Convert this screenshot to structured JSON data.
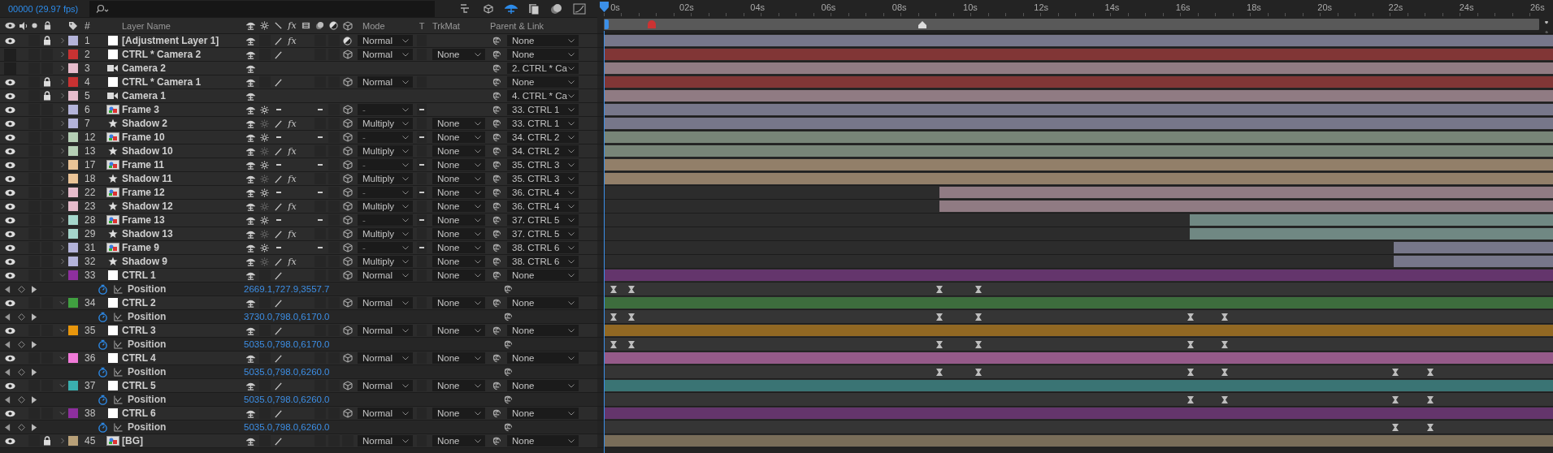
{
  "top_bar": {
    "frame_info": "00000 (29.97 fps)"
  },
  "columns": {
    "number": "#",
    "layer_name": "Layer Name",
    "fx": "fx",
    "mode": "Mode",
    "t": "T",
    "trkmat": "TrkMat",
    "parent": "Parent & Link"
  },
  "ruler": {
    "labels": [
      "0s",
      "02s",
      "04s",
      "06s",
      "08s",
      "10s",
      "12s",
      "14s",
      "16s",
      "18s",
      "20s",
      "22s",
      "24s",
      "26s"
    ]
  },
  "layers": [
    {
      "number": "1",
      "name": "[Adjustment Layer 1]",
      "color": "#b3b3d9",
      "visible": true,
      "locked": true,
      "expanded": false,
      "source": {
        "kind": "solid"
      },
      "switches": {
        "kind": "adjustment"
      },
      "fx_label": "fx",
      "effects_on": true,
      "mode": "Normal",
      "t_switch": {
        "kind": "box"
      },
      "parent": "None",
      "bar": {
        "level": 1
      }
    },
    {
      "number": "2",
      "name": "CTRL * Camera 2",
      "color": "#c83232",
      "visible": false,
      "locked": false,
      "expanded": false,
      "source": {
        "kind": "solid"
      },
      "switches": {
        "kind": "solid"
      },
      "three_d": true,
      "mode": "Normal",
      "t_switch": {
        "kind": "box"
      },
      "trkmat": "None",
      "parent": "None",
      "bar": {
        "level": 1
      }
    },
    {
      "number": "3",
      "name": "Camera 2",
      "color": "#e6bccc",
      "visible": false,
      "locked": false,
      "expanded": false,
      "source": {
        "kind": "camera"
      },
      "switches": {
        "kind": "camera"
      },
      "parent": "2. CTRL * Ca",
      "bar": {
        "level": 1
      }
    },
    {
      "number": "4",
      "name": "CTRL * Camera 1",
      "color": "#c83232",
      "visible": true,
      "locked": true,
      "expanded": false,
      "source": {
        "kind": "solid"
      },
      "switches": {
        "kind": "solid"
      },
      "three_d": true,
      "mode": "Normal",
      "t_switch": {
        "kind": "box"
      },
      "parent": "None",
      "bar": {
        "level": 1
      }
    },
    {
      "number": "5",
      "name": "Camera 1",
      "color": "#e6bccc",
      "visible": true,
      "locked": true,
      "expanded": false,
      "source": {
        "kind": "camera"
      },
      "switches": {
        "kind": "camera"
      },
      "parent": "4. CTRL * Ca",
      "bar": {
        "level": 1
      }
    },
    {
      "number": "6",
      "name": "Frame 3",
      "color": "#b3b3d9",
      "visible": true,
      "locked": false,
      "expanded": false,
      "source": {
        "kind": "footage"
      },
      "switches": {
        "kind": "footage"
      },
      "three_d": true,
      "mode": "-",
      "t_switch": {
        "kind": "dash"
      },
      "parent": "33. CTRL 1",
      "bar": {
        "level": 1
      }
    },
    {
      "number": "7",
      "name": "Shadow 2",
      "color": "#b3b3d9",
      "visible": true,
      "locked": false,
      "expanded": false,
      "source": {
        "kind": "shape"
      },
      "switches": {
        "kind": "shape"
      },
      "fx_label": "fx",
      "effects_on": true,
      "three_d": true,
      "mode": "Multiply",
      "t_switch": {
        "kind": "box"
      },
      "trkmat": "None",
      "parent": "33. CTRL 1",
      "bar": {
        "level": 1
      }
    },
    {
      "number": "12",
      "name": "Frame 10",
      "color": "#b5cfb5",
      "visible": true,
      "locked": false,
      "expanded": false,
      "source": {
        "kind": "footage"
      },
      "switches": {
        "kind": "footage"
      },
      "three_d": true,
      "mode": "-",
      "t_switch": {
        "kind": "dash"
      },
      "trkmat": "None",
      "parent": "34. CTRL 2",
      "bar": {
        "level": 1
      }
    },
    {
      "number": "13",
      "name": "Shadow 10",
      "color": "#b5cfb5",
      "visible": true,
      "locked": false,
      "expanded": false,
      "source": {
        "kind": "shape"
      },
      "switches": {
        "kind": "shape"
      },
      "fx_label": "fx",
      "effects_on": true,
      "three_d": true,
      "mode": "Multiply",
      "t_switch": {
        "kind": "box"
      },
      "trkmat": "None",
      "parent": "34. CTRL 2",
      "bar": {
        "level": 1
      }
    },
    {
      "number": "17",
      "name": "Frame 11",
      "color": "#eac497",
      "visible": true,
      "locked": false,
      "expanded": false,
      "source": {
        "kind": "footage"
      },
      "switches": {
        "kind": "footage"
      },
      "three_d": true,
      "mode": "-",
      "t_switch": {
        "kind": "dash"
      },
      "trkmat": "None",
      "parent": "35. CTRL 3",
      "bar": {
        "level": 1
      }
    },
    {
      "number": "18",
      "name": "Shadow 11",
      "color": "#eac497",
      "visible": true,
      "locked": false,
      "expanded": false,
      "source": {
        "kind": "shape"
      },
      "switches": {
        "kind": "shape"
      },
      "fx_label": "fx",
      "effects_on": true,
      "three_d": true,
      "mode": "Multiply",
      "t_switch": {
        "kind": "box"
      },
      "trkmat": "None",
      "parent": "35. CTRL 3",
      "bar": {
        "level": 1
      }
    },
    {
      "number": "22",
      "name": "Frame 12",
      "color": "#e6bccc",
      "visible": true,
      "locked": false,
      "expanded": false,
      "source": {
        "kind": "footage"
      },
      "switches": {
        "kind": "footage"
      },
      "three_d": true,
      "mode": "-",
      "t_switch": {
        "kind": "dash"
      },
      "trkmat": "None",
      "parent": "36. CTRL 4",
      "bar": {
        "level": 0.646
      }
    },
    {
      "number": "23",
      "name": "Shadow 12",
      "color": "#e6bccc",
      "visible": true,
      "locked": false,
      "expanded": false,
      "source": {
        "kind": "shape"
      },
      "switches": {
        "kind": "shape"
      },
      "fx_label": "fx",
      "effects_on": true,
      "three_d": true,
      "mode": "Multiply",
      "t_switch": {
        "kind": "box"
      },
      "trkmat": "None",
      "parent": "36. CTRL 4",
      "bar": {
        "level": 0.646
      }
    },
    {
      "number": "28",
      "name": "Frame 13",
      "color": "#a5d6cc",
      "visible": true,
      "locked": false,
      "expanded": false,
      "source": {
        "kind": "footage"
      },
      "switches": {
        "kind": "footage"
      },
      "three_d": true,
      "mode": "-",
      "t_switch": {
        "kind": "dash"
      },
      "trkmat": "None",
      "parent": "37. CTRL 5",
      "bar": {
        "level": 0.383
      }
    },
    {
      "number": "29",
      "name": "Shadow 13",
      "color": "#a5d6cc",
      "visible": true,
      "locked": false,
      "expanded": false,
      "source": {
        "kind": "shape"
      },
      "switches": {
        "kind": "shape"
      },
      "fx_label": "fx",
      "effects_on": true,
      "three_d": true,
      "mode": "Multiply",
      "t_switch": {
        "kind": "box"
      },
      "trkmat": "None",
      "parent": "37. CTRL 5",
      "bar": {
        "level": 0.383
      }
    },
    {
      "number": "31",
      "name": "Frame 9",
      "color": "#b3b3d9",
      "visible": true,
      "locked": false,
      "expanded": false,
      "source": {
        "kind": "footage"
      },
      "switches": {
        "kind": "footage"
      },
      "three_d": true,
      "mode": "-",
      "t_switch": {
        "kind": "dash"
      },
      "trkmat": "None",
      "parent": "38. CTRL 6",
      "bar": {
        "level": 0.168
      }
    },
    {
      "number": "32",
      "name": "Shadow 9",
      "color": "#b3b3d9",
      "visible": true,
      "locked": false,
      "expanded": false,
      "source": {
        "kind": "shape"
      },
      "switches": {
        "kind": "shape"
      },
      "fx_label": "fx",
      "effects_on": true,
      "three_d": true,
      "mode": "Multiply",
      "t_switch": {
        "kind": "box"
      },
      "trkmat": "None",
      "parent": "38. CTRL 6",
      "bar": {
        "level": 0.168
      }
    },
    {
      "number": "33",
      "name": "CTRL 1",
      "color": "#8e2f9e",
      "visible": true,
      "locked": false,
      "expanded": true,
      "source": {
        "kind": "solid"
      },
      "switches": {
        "kind": "solid"
      },
      "three_d": true,
      "mode": "Normal",
      "t_switch": {
        "kind": "box"
      },
      "trkmat": "None",
      "parent": "None",
      "bar": {
        "level": 1
      },
      "position": {
        "label": "Position",
        "value": "2669.1,727.9,3557.7",
        "keyframes": [
          {
            "level": 0.01
          },
          {
            "level": 0.029
          },
          {
            "level": 0.354
          },
          {
            "level": 0.395
          }
        ]
      }
    },
    {
      "number": "34",
      "name": "CTRL 2",
      "color": "#40a040",
      "visible": true,
      "locked": false,
      "expanded": true,
      "source": {
        "kind": "solid"
      },
      "switches": {
        "kind": "solid"
      },
      "three_d": true,
      "mode": "Normal",
      "t_switch": {
        "kind": "box"
      },
      "trkmat": "None",
      "parent": "None",
      "bar": {
        "level": 1
      },
      "position": {
        "label": "Position",
        "value": "3730.0,798.0,6170.0",
        "keyframes": [
          {
            "level": 0.01
          },
          {
            "level": 0.029
          },
          {
            "level": 0.354
          },
          {
            "level": 0.395
          },
          {
            "level": 0.618
          },
          {
            "level": 0.654
          }
        ]
      }
    },
    {
      "number": "35",
      "name": "CTRL 3",
      "color": "#e8960c",
      "visible": true,
      "locked": false,
      "expanded": true,
      "source": {
        "kind": "solid"
      },
      "switches": {
        "kind": "solid"
      },
      "three_d": true,
      "mode": "Normal",
      "t_switch": {
        "kind": "box"
      },
      "trkmat": "None",
      "parent": "None",
      "bar": {
        "level": 1
      },
      "position": {
        "label": "Position",
        "value": "5035.0,798.0,6170.0",
        "keyframes": [
          {
            "level": 0.01
          },
          {
            "level": 0.029
          },
          {
            "level": 0.354
          },
          {
            "level": 0.395
          },
          {
            "level": 0.618
          },
          {
            "level": 0.654
          }
        ]
      }
    },
    {
      "number": "36",
      "name": "CTRL 4",
      "color": "#f07ad8",
      "visible": true,
      "locked": false,
      "expanded": true,
      "source": {
        "kind": "solid"
      },
      "switches": {
        "kind": "solid"
      },
      "three_d": true,
      "mode": "Normal",
      "t_switch": {
        "kind": "box"
      },
      "trkmat": "None",
      "parent": "None",
      "bar": {
        "level": 1
      },
      "position": {
        "label": "Position",
        "value": "5035.0,798.0,6260.0",
        "keyframes": [
          {
            "level": 0.354
          },
          {
            "level": 0.395
          },
          {
            "level": 0.618
          },
          {
            "level": 0.654
          },
          {
            "level": 0.834
          },
          {
            "level": 0.871
          }
        ]
      }
    },
    {
      "number": "37",
      "name": "CTRL 5",
      "color": "#3aaeae",
      "visible": true,
      "locked": false,
      "expanded": true,
      "source": {
        "kind": "solid"
      },
      "switches": {
        "kind": "solid"
      },
      "three_d": true,
      "mode": "Normal",
      "t_switch": {
        "kind": "box"
      },
      "trkmat": "None",
      "parent": "None",
      "bar": {
        "level": 1
      },
      "position": {
        "label": "Position",
        "value": "5035.0,798.0,6260.0",
        "keyframes": [
          {
            "level": 0.618
          },
          {
            "level": 0.654
          },
          {
            "level": 0.834
          },
          {
            "level": 0.871
          }
        ]
      }
    },
    {
      "number": "38",
      "name": "CTRL 6",
      "color": "#8e2f9e",
      "visible": true,
      "locked": false,
      "expanded": true,
      "source": {
        "kind": "solid"
      },
      "switches": {
        "kind": "solid"
      },
      "three_d": true,
      "mode": "Normal",
      "t_switch": {
        "kind": "box"
      },
      "trkmat": "None",
      "parent": "None",
      "bar": {
        "level": 1
      },
      "position": {
        "label": "Position",
        "value": "5035.0,798.0,6260.0",
        "keyframes": [
          {
            "level": 0.834
          },
          {
            "level": 0.871
          }
        ]
      }
    },
    {
      "number": "45",
      "name": "[BG]",
      "color": "#b8a078",
      "visible": true,
      "locked": true,
      "expanded": false,
      "source": {
        "kind": "footage"
      },
      "switches": {
        "kind": "solid"
      },
      "three_d": false,
      "mode": "Normal",
      "t_switch": {
        "kind": "box"
      },
      "trkmat": "None",
      "parent": "None",
      "bar": {
        "level": 1
      }
    }
  ]
}
